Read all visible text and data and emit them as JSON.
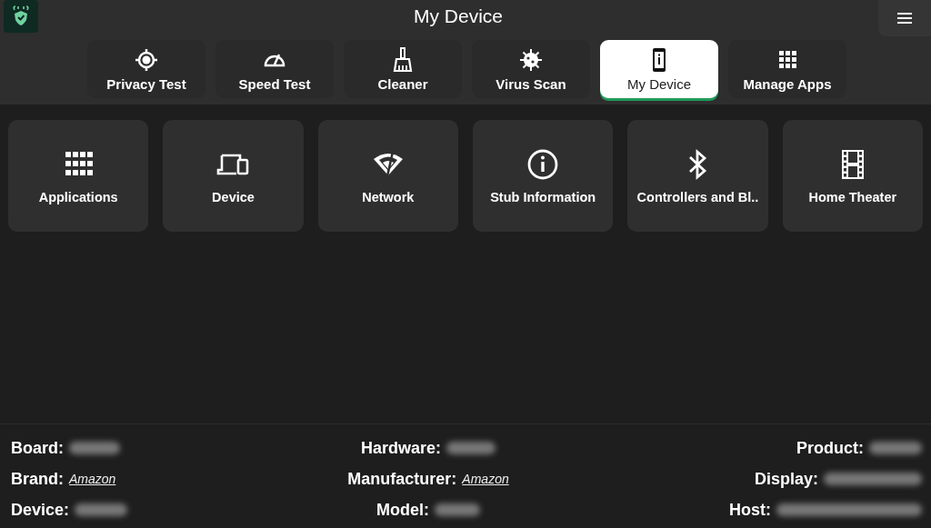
{
  "header": {
    "title": "My Device"
  },
  "tabs": [
    {
      "label": "Privacy Test",
      "selected": false
    },
    {
      "label": "Speed Test",
      "selected": false
    },
    {
      "label": "Cleaner",
      "selected": false
    },
    {
      "label": "Virus Scan",
      "selected": false
    },
    {
      "label": "My Device",
      "selected": true
    },
    {
      "label": "Manage Apps",
      "selected": false
    }
  ],
  "cards": [
    {
      "label": "Applications"
    },
    {
      "label": "Device"
    },
    {
      "label": "Network"
    },
    {
      "label": "Stub Information"
    },
    {
      "label": "Controllers and Bl.."
    },
    {
      "label": "Home Theater"
    }
  ],
  "info_columns": [
    {
      "rows": [
        {
          "label": "Board:",
          "redacted": true
        },
        {
          "label": "Brand:",
          "value": "Amazon",
          "redacted": false
        },
        {
          "label": "Device:",
          "redacted": true
        }
      ]
    },
    {
      "rows": [
        {
          "label": "Hardware:",
          "redacted": true
        },
        {
          "label": "Manufacturer:",
          "value": "Amazon",
          "redacted": false
        },
        {
          "label": "Model:",
          "redacted": true
        }
      ]
    },
    {
      "rows": [
        {
          "label": "Product:",
          "redacted": true
        },
        {
          "label": "Display:",
          "redacted": true
        },
        {
          "label": "Host:",
          "redacted": true
        }
      ]
    }
  ]
}
